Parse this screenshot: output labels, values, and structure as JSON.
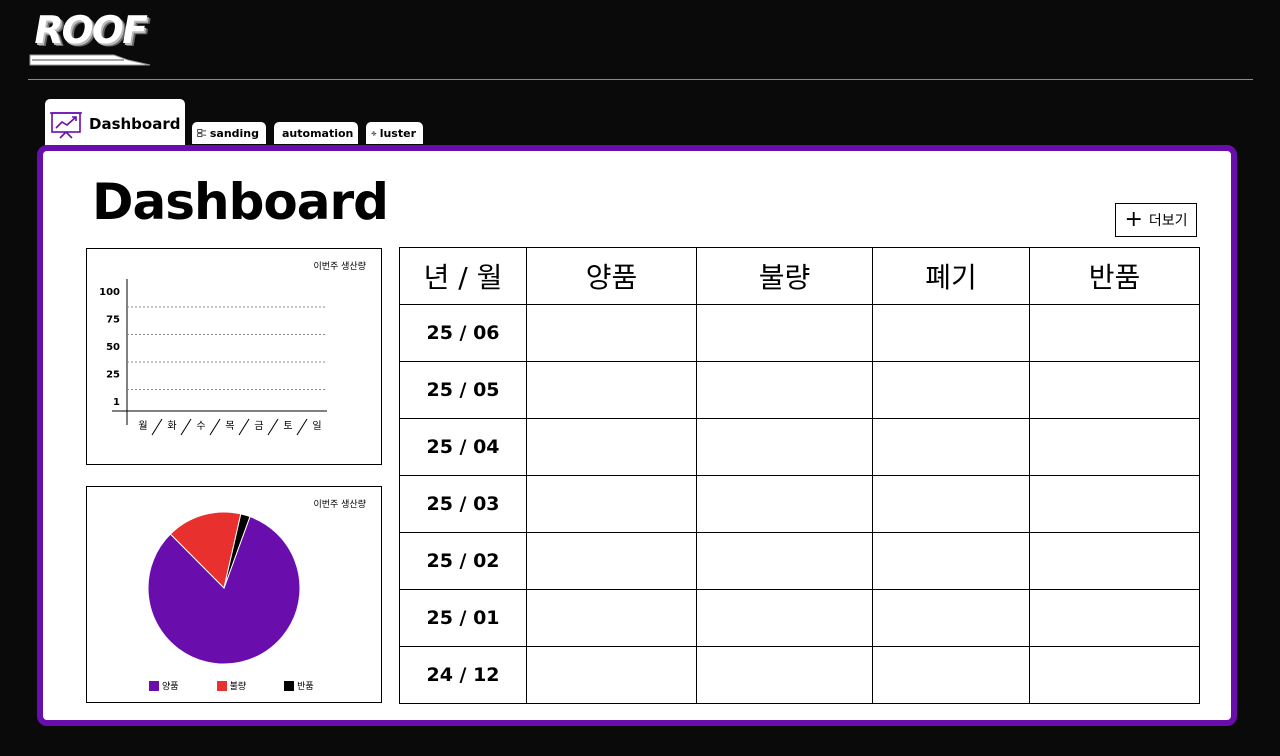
{
  "header": {
    "logo_text": "ROOF"
  },
  "tabs": [
    {
      "label": "Dashboard",
      "icon": "presentation-chart-icon"
    },
    {
      "label": "sanding",
      "icon": "sanding-icon"
    },
    {
      "label": "automation",
      "icon": "robot-arm-icon"
    },
    {
      "label": "luster",
      "icon": "sparkle-icon"
    }
  ],
  "page": {
    "title": "Dashboard",
    "more_button_label": "더보기"
  },
  "line_chart": {
    "title": "이번주 생산량",
    "chart_data": {
      "type": "line",
      "categories": [
        "월",
        "화",
        "수",
        "목",
        "금",
        "토",
        "일"
      ],
      "y_ticks": [
        "100",
        "75",
        "50",
        "25",
        "1"
      ],
      "series": [],
      "grid": "dotted"
    }
  },
  "pie_chart": {
    "title": "이번주 생산량",
    "chart_data": {
      "type": "pie",
      "labels": [
        "양품",
        "불량",
        "반품"
      ],
      "values": [
        82,
        16,
        2
      ],
      "colors": [
        "#6a0dad",
        "#e8302f",
        "#000000"
      ]
    }
  },
  "table": {
    "headers": [
      "년 / 월",
      "양품",
      "불량",
      "폐기",
      "반품"
    ],
    "rows": [
      {
        "period": "25 / 06",
        "good": "",
        "defect": "",
        "discard": "",
        "return": ""
      },
      {
        "period": "25 / 05",
        "good": "",
        "defect": "",
        "discard": "",
        "return": ""
      },
      {
        "period": "25 / 04",
        "good": "",
        "defect": "",
        "discard": "",
        "return": ""
      },
      {
        "period": "25 / 03",
        "good": "",
        "defect": "",
        "discard": "",
        "return": ""
      },
      {
        "period": "25 / 02",
        "good": "",
        "defect": "",
        "discard": "",
        "return": ""
      },
      {
        "period": "25 / 01",
        "good": "",
        "defect": "",
        "discard": "",
        "return": ""
      },
      {
        "period": "24 / 12",
        "good": "",
        "defect": "",
        "discard": "",
        "return": ""
      }
    ]
  },
  "colors": {
    "accent": "#6a0dad",
    "defect": "#e8302f",
    "background": "#0a0a0a"
  }
}
